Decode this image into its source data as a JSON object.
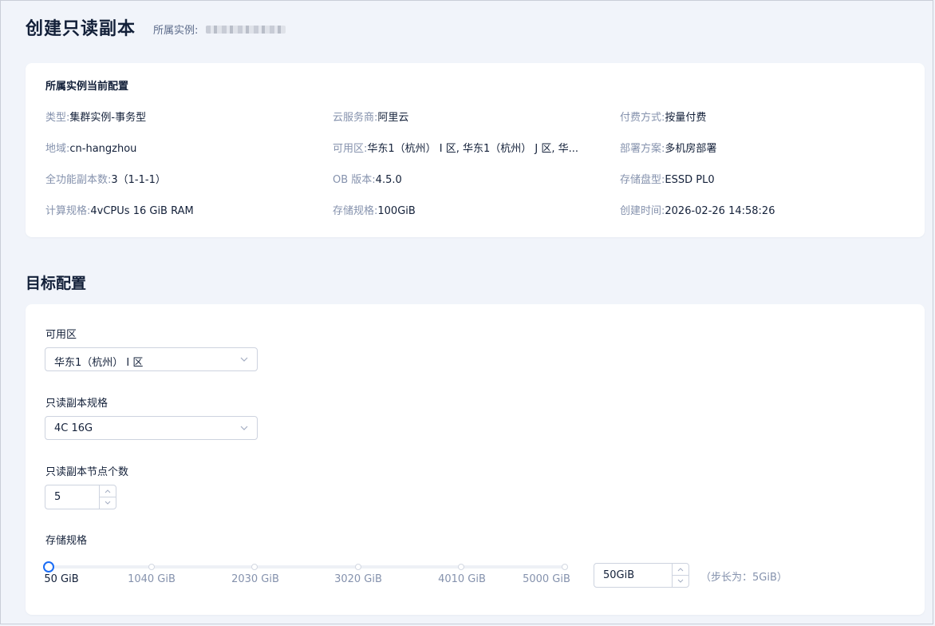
{
  "header": {
    "title": "创建只读副本",
    "instance_label": "所属实例:"
  },
  "current_config": {
    "title": "所属实例当前配置",
    "items": [
      {
        "label": "类型:",
        "value": "集群实例-事务型"
      },
      {
        "label": "云服务商:",
        "value": "阿里云"
      },
      {
        "label": "付费方式:",
        "value": "按量付费"
      },
      {
        "label": "地域:",
        "value": "cn-hangzhou"
      },
      {
        "label": "可用区:",
        "value": "华东1（杭州） I 区, 华东1（杭州） J 区, 华..."
      },
      {
        "label": "部署方案:",
        "value": "多机房部署"
      },
      {
        "label": "全功能副本数:",
        "value": "3（1-1-1）"
      },
      {
        "label": "OB 版本:",
        "value": "4.5.0"
      },
      {
        "label": "存储盘型:",
        "value": "ESSD PL0"
      },
      {
        "label": "计算规格:",
        "value": "4vCPUs 16 GiB RAM"
      },
      {
        "label": "存储规格:",
        "value": "100GiB"
      },
      {
        "label": "创建时间:",
        "value": "2026-02-26 14:58:26"
      }
    ]
  },
  "target_config": {
    "title": "目标配置",
    "zone": {
      "label": "可用区",
      "value": "华东1（杭州） I 区"
    },
    "spec": {
      "label": "只读副本规格",
      "value": "4C 16G"
    },
    "node_count": {
      "label": "只读副本节点个数",
      "value": "5"
    },
    "storage": {
      "label": "存储规格",
      "marks": [
        "50 GiB",
        "1040 GiB",
        "2030 GiB",
        "3020 GiB",
        "4010 GiB",
        "5000 GiB"
      ],
      "value": "50GiB",
      "slider_value_gib": 50,
      "min_gib": 50,
      "max_gib": 5000,
      "step_hint": "（步长为：5GiB）"
    }
  },
  "colors": {
    "accent": "#1a6cf5",
    "page_bg": "#f1f4fa",
    "label": "#8592ad",
    "text": "#132039"
  }
}
